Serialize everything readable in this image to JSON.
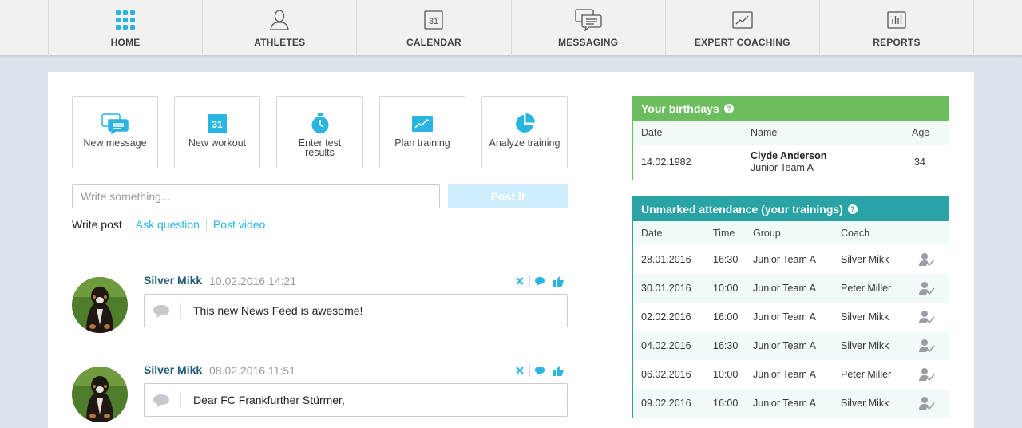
{
  "nav": {
    "items": [
      {
        "label": "HOME",
        "icon": "grid-icon"
      },
      {
        "label": "ATHLETES",
        "icon": "person-icon"
      },
      {
        "label": "CALENDAR",
        "icon": "calendar-icon",
        "icon_text": "31"
      },
      {
        "label": "MESSAGING",
        "icon": "chat-icon"
      },
      {
        "label": "EXPERT COACHING",
        "icon": "chart-icon"
      },
      {
        "label": "REPORTS",
        "icon": "report-icon"
      }
    ],
    "active_color": "#2ab4e0"
  },
  "quick_actions": [
    {
      "label": "New message",
      "icon": "chat-icon"
    },
    {
      "label": "New workout",
      "icon": "calendar-icon",
      "icon_text": "31"
    },
    {
      "label": "Enter test results",
      "icon": "stopwatch-icon"
    },
    {
      "label": "Plan training",
      "icon": "chart-icon"
    },
    {
      "label": "Analyze training",
      "icon": "pie-icon"
    }
  ],
  "composer": {
    "placeholder": "Write something...",
    "post_label": "Post it",
    "tabs": [
      "Write post",
      "Ask question",
      "Post video"
    ]
  },
  "posts": [
    {
      "author": "Silver Mikk",
      "date": "10.02.2016 14:21",
      "text": "This new News Feed is awesome!"
    },
    {
      "author": "Silver Mikk",
      "date": "08.02.2016 11:51",
      "text": "Dear FC Frankfurther Stürmer,"
    }
  ],
  "birthdays": {
    "title": "Your birthdays",
    "color": "#6bbd5e",
    "headers": {
      "date": "Date",
      "name": "Name",
      "age": "Age"
    },
    "rows": [
      {
        "date": "14.02.1982",
        "name": "Clyde Anderson",
        "group": "Junior Team A",
        "age": "34"
      }
    ]
  },
  "attendance": {
    "title": "Unmarked attendance (your trainings)",
    "color": "#2aa3a6",
    "headers": {
      "date": "Date",
      "time": "Time",
      "group": "Group",
      "coach": "Coach"
    },
    "rows": [
      {
        "date": "28.01.2016",
        "time": "16:30",
        "group": "Junior Team A",
        "coach": "Silver Mikk"
      },
      {
        "date": "30.01.2016",
        "time": "10:00",
        "group": "Junior Team A",
        "coach": "Peter Miller"
      },
      {
        "date": "02.02.2016",
        "time": "16:00",
        "group": "Junior Team A",
        "coach": "Silver Mikk"
      },
      {
        "date": "04.02.2016",
        "time": "16:30",
        "group": "Junior Team A",
        "coach": "Silver Mikk"
      },
      {
        "date": "06.02.2016",
        "time": "10:00",
        "group": "Junior Team A",
        "coach": "Peter Miller"
      },
      {
        "date": "09.02.2016",
        "time": "16:00",
        "group": "Junior Team A",
        "coach": "Silver Mikk"
      }
    ]
  }
}
